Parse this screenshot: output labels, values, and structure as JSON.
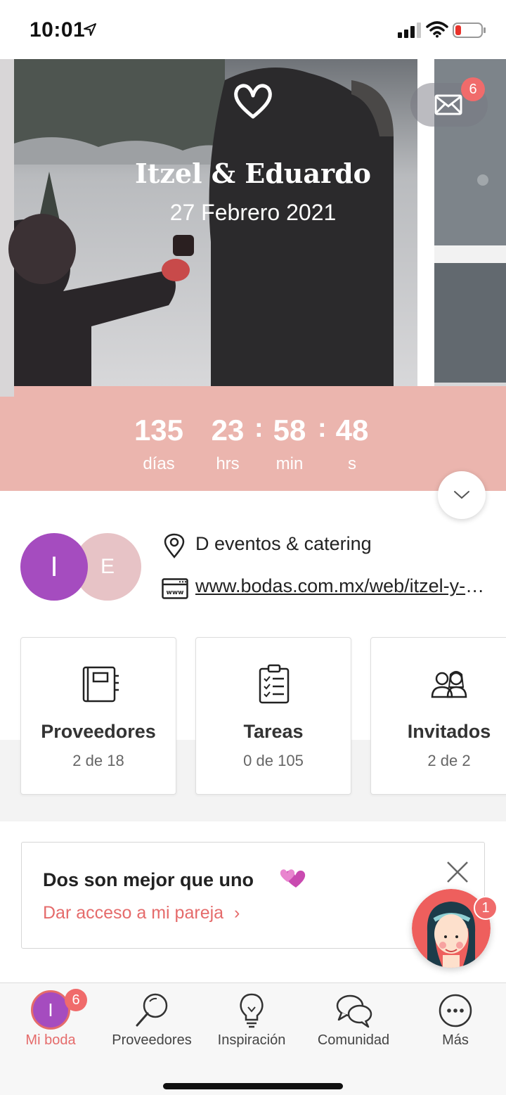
{
  "status_bar": {
    "time": "10:01"
  },
  "hero": {
    "couple_names": "Itzel & Eduardo",
    "wedding_date": "27 Febrero 2021",
    "mail_badge": "6",
    "countdown": {
      "days": "135",
      "days_label": "días",
      "hours": "23",
      "hours_label": "hrs",
      "minutes": "58",
      "minutes_label": "min",
      "seconds": "48",
      "seconds_label": "s",
      "separator": ":"
    }
  },
  "profile": {
    "avatar_partner_1": "I",
    "avatar_partner_2": "E",
    "venue": "D eventos & catering",
    "website": "www.bodas.com.mx/web/itzel-y-eduardo"
  },
  "cards": [
    {
      "title": "Proveedores",
      "subtitle": "2 de 18",
      "icon": "notebook-icon"
    },
    {
      "title": "Tareas",
      "subtitle": "0 de 105",
      "icon": "checklist-icon"
    },
    {
      "title": "Invitados",
      "subtitle": "2 de 2",
      "icon": "guests-icon"
    }
  ],
  "promo": {
    "title": "Dos son mejor que uno",
    "link": "Dar acceso a mi pareja",
    "chevron": "›"
  },
  "chat": {
    "badge": "1"
  },
  "tabbar": {
    "items": [
      {
        "label": "Mi boda",
        "avatar": "I",
        "badge": "6",
        "active": true
      },
      {
        "label": "Proveedores",
        "icon": "search-icon"
      },
      {
        "label": "Inspiración",
        "icon": "lightbulb-icon"
      },
      {
        "label": "Comunidad",
        "icon": "chat-bubbles-icon"
      },
      {
        "label": "Más",
        "icon": "more-icon"
      }
    ]
  },
  "colors": {
    "accent": "#e56b6b",
    "countdown_bg": "#ebb5ae",
    "avatar_primary": "#a54cbf",
    "avatar_secondary": "#e7c3c6"
  }
}
